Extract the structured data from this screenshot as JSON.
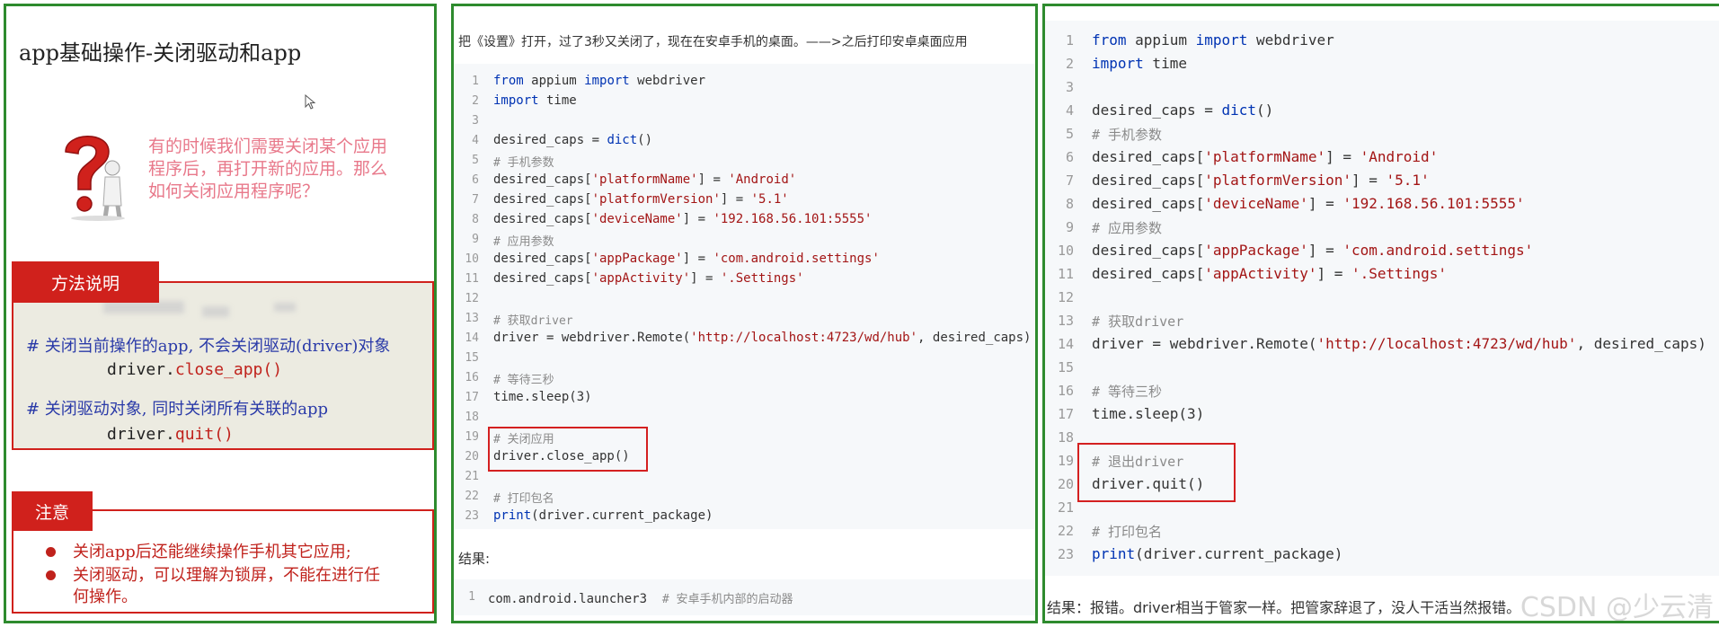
{
  "panel1": {
    "title": "app基础操作-关闭驱动和app",
    "question": "有的时候我们需要关闭某个应用程序后，再打开新的应用。那么如何关闭应用程序呢？",
    "method_tab": "方法说明",
    "method": {
      "comment1": "# 关闭当前操作的app, 不会关闭驱动(driver)对象",
      "code1_obj": "driver.",
      "code1_fn": "close_app()",
      "comment2": "# 关闭驱动对象, 同时关闭所有关联的app",
      "code2_obj": "driver.",
      "code2_fn": "quit()"
    },
    "note_tab": "注意",
    "notes": [
      "关闭app后还能继续操作手机其它应用;",
      "关闭驱动，可以理解为锁屏，不能在进行任何操作。"
    ]
  },
  "panel2": {
    "intro": "把《设置》打开，过了3秒又关闭了，现在在安卓手机的桌面。——>之后打印安卓桌面应用",
    "line_numbers": [
      "1",
      "2",
      "3",
      "4",
      "5",
      "6",
      "7",
      "8",
      "9",
      "10",
      "11",
      "12",
      "13",
      "14",
      "15",
      "16",
      "17",
      "18",
      "19",
      "20",
      "21",
      "22",
      "23"
    ],
    "result_label": "结果:",
    "result_line_number": "1",
    "result_code": "com.android.launcher3",
    "result_comment": "# 安卓手机内部的启动器"
  },
  "panel3": {
    "line_numbers": [
      "1",
      "2",
      "3",
      "4",
      "5",
      "6",
      "7",
      "8",
      "9",
      "10",
      "11",
      "12",
      "13",
      "14",
      "15",
      "16",
      "17",
      "18",
      "19",
      "20",
      "21",
      "22",
      "23"
    ],
    "result_text": "结果：报错。driver相当于管家一样。把管家辞退了，没人干活当然报错。",
    "watermark": "CSDN @少云清"
  },
  "code": {
    "l1_from": "from",
    "l1_mod": " appium ",
    "l1_import": "import",
    "l1_name": " webdriver",
    "l2_import": "import",
    "l2_name": " time",
    "l4_a": "desired_caps = ",
    "l4_b": "dict",
    "l4_c": "()",
    "l5": "# 手机参数",
    "l6_a": "desired_caps[",
    "l6_k": "'platformName'",
    "l6_b": "] = ",
    "l6_v": "'Android'",
    "l7_a": "desired_caps[",
    "l7_k": "'platformVersion'",
    "l7_b": "] = ",
    "l7_v": "'5.1'",
    "l8_a": "desired_caps[",
    "l8_k": "'deviceName'",
    "l8_b": "] = ",
    "l8_v": "'192.168.56.101:5555'",
    "l9": "# 应用参数",
    "l10_a": "desired_caps[",
    "l10_k": "'appPackage'",
    "l10_b": "] = ",
    "l10_v": "'com.android.settings'",
    "l11_a": "desired_caps[",
    "l11_k": "'appActivity'",
    "l11_b": "] = ",
    "l11_v": "'.Settings'",
    "l13": "# 获取driver",
    "l14_a": "driver = webdriver.Remote(",
    "l14_s": "'http://localhost:4723/wd/hub'",
    "l14_b": ", desired_caps)",
    "l16": "# 等待三秒",
    "l17": "time.sleep(3)",
    "p2_l19": "# 关闭应用",
    "p2_l20": "driver.close_app()",
    "p3_l19": "# 退出driver",
    "p3_l20": "driver.quit()",
    "l22": "# 打印包名",
    "l23_a": "print",
    "l23_b": "(driver.current_package)"
  }
}
